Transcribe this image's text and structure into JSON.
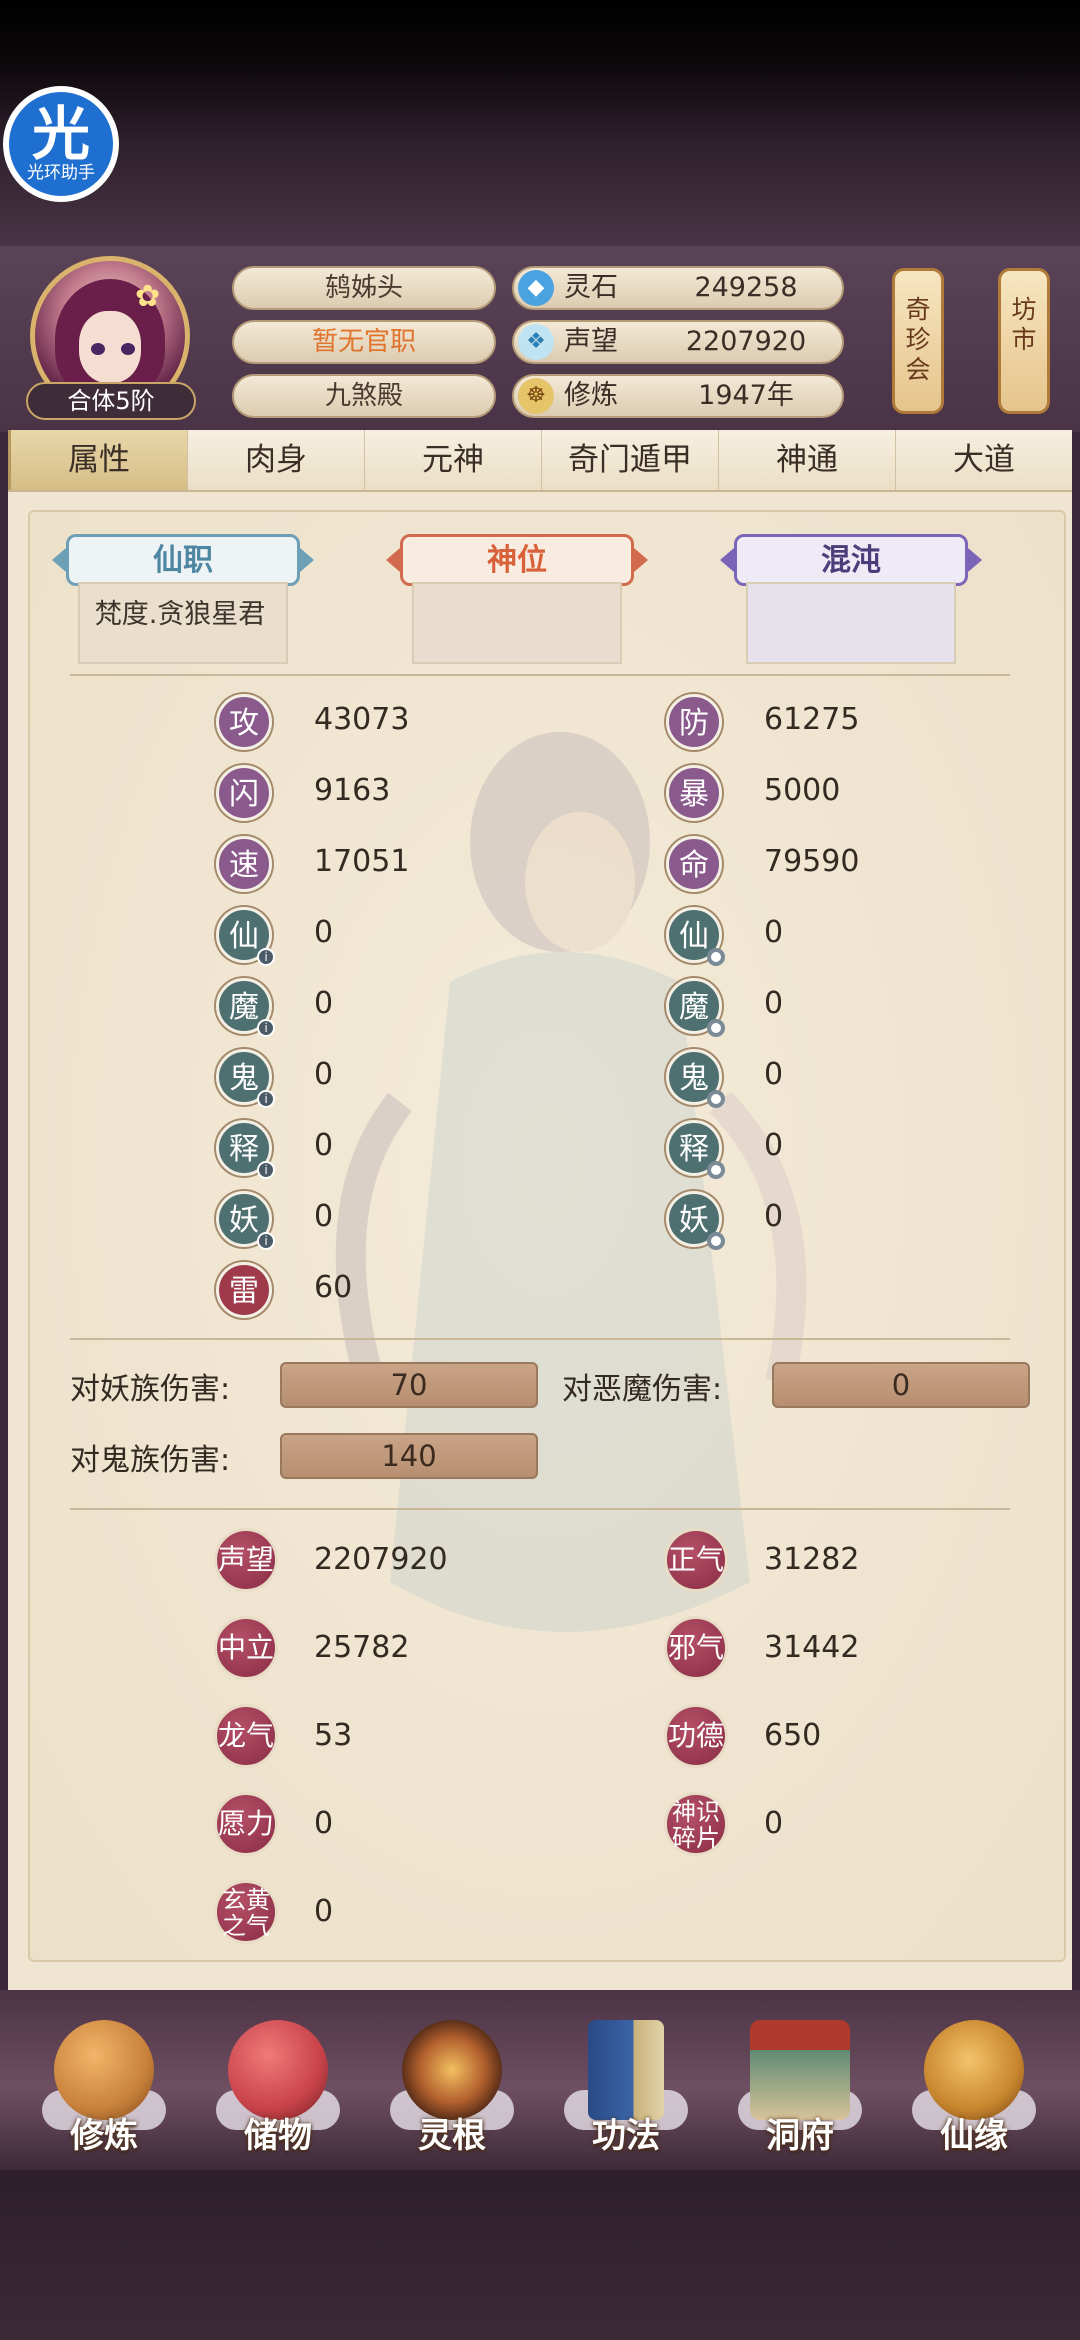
{
  "helper": {
    "glyph": "光",
    "label": "光环助手"
  },
  "profile": {
    "realm": "合体5阶",
    "title": "鸫姊头",
    "official_post": "暂无官职",
    "faction": "九煞殿"
  },
  "resources": [
    {
      "icon": "spirit-stone-icon",
      "label": "灵石",
      "value": "249258"
    },
    {
      "icon": "reputation-icon",
      "label": "声望",
      "value": "2207920"
    },
    {
      "icon": "cultivation-icon",
      "label": "修炼",
      "value": "1947年"
    }
  ],
  "side_buttons": {
    "rare_auction": "奇珍会",
    "market": "坊市"
  },
  "tabs": [
    "属性",
    "肉身",
    "元神",
    "奇门遁甲",
    "神通",
    "大道"
  ],
  "active_tab": "属性",
  "ranks": [
    {
      "label": "仙职",
      "value": "梵度.贪狼星君",
      "color": "#6d9fb7"
    },
    {
      "label": "神位",
      "value": "",
      "color": "#d26a4e"
    },
    {
      "label": "混沌",
      "value": "",
      "color": "#7a65b8"
    }
  ],
  "stats_left": [
    {
      "glyph": "攻",
      "value": "43073",
      "kind": "purple"
    },
    {
      "glyph": "闪",
      "value": "9163",
      "kind": "purple"
    },
    {
      "glyph": "速",
      "value": "17051",
      "kind": "purple"
    },
    {
      "glyph": "仙",
      "value": "0",
      "kind": "teal-a"
    },
    {
      "glyph": "魔",
      "value": "0",
      "kind": "teal-a"
    },
    {
      "glyph": "鬼",
      "value": "0",
      "kind": "teal-a"
    },
    {
      "glyph": "释",
      "value": "0",
      "kind": "teal-a"
    },
    {
      "glyph": "妖",
      "value": "0",
      "kind": "teal-a"
    },
    {
      "glyph": "雷",
      "value": "60",
      "kind": "red"
    }
  ],
  "stats_right": [
    {
      "glyph": "防",
      "value": "61275",
      "kind": "purple"
    },
    {
      "glyph": "暴",
      "value": "5000",
      "kind": "purple"
    },
    {
      "glyph": "命",
      "value": "79590",
      "kind": "purple"
    },
    {
      "glyph": "仙",
      "value": "0",
      "kind": "teal-d"
    },
    {
      "glyph": "魔",
      "value": "0",
      "kind": "teal-d"
    },
    {
      "glyph": "鬼",
      "value": "0",
      "kind": "teal-d"
    },
    {
      "glyph": "释",
      "value": "0",
      "kind": "teal-d"
    },
    {
      "glyph": "妖",
      "value": "0",
      "kind": "teal-d"
    }
  ],
  "damage": [
    {
      "label": "对妖族伤害:",
      "value": "70"
    },
    {
      "label": "对恶魔伤害:",
      "value": "0"
    },
    {
      "label": "对鬼族伤害:",
      "value": "140"
    }
  ],
  "honors_left": [
    {
      "glyph": "声望",
      "value": "2207920"
    },
    {
      "glyph": "中立",
      "value": "25782"
    },
    {
      "glyph": "龙气",
      "value": "53"
    },
    {
      "glyph": "愿力",
      "value": "0"
    },
    {
      "glyph": "玄黄之气",
      "value": "0"
    }
  ],
  "honors_right": [
    {
      "glyph": "正气",
      "value": "31282"
    },
    {
      "glyph": "邪气",
      "value": "31442"
    },
    {
      "glyph": "功德",
      "value": "650"
    },
    {
      "glyph": "神识碎片",
      "value": "0"
    }
  ],
  "nav": [
    {
      "label": "修炼",
      "icon": "meditation-icon",
      "color": "#c9823b"
    },
    {
      "label": "储物",
      "icon": "storage-bag-icon",
      "color": "#c8434a"
    },
    {
      "label": "灵根",
      "icon": "spirit-root-icon",
      "color": "#b4612e"
    },
    {
      "label": "功法",
      "icon": "technique-book-icon",
      "color": "#3b64a8"
    },
    {
      "label": "洞府",
      "icon": "cave-abode-icon",
      "color": "#5f8a72"
    },
    {
      "label": "仙缘",
      "icon": "gourd-icon",
      "color": "#c8862e"
    }
  ]
}
